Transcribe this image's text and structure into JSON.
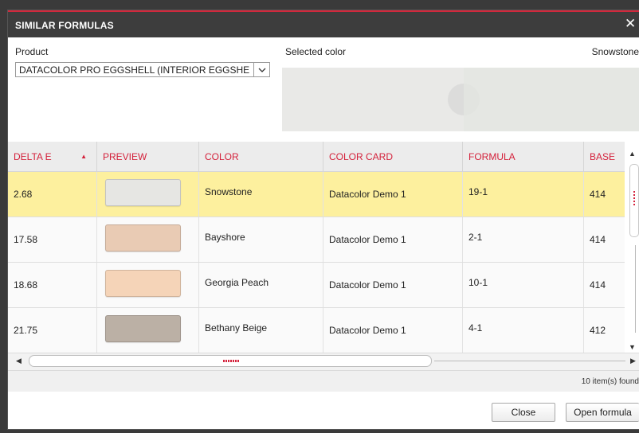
{
  "dialog": {
    "title": "SIMILAR FORMULAS",
    "close_glyph": "✕"
  },
  "product": {
    "label": "Product",
    "selected": "DATACOLOR PRO EGGSHELL (INTERIOR EGGSHELL)"
  },
  "selected_color": {
    "label": "Selected color",
    "name": "Snowstone",
    "left_color": "#e9e9e7",
    "right_color": "#e5e7e3"
  },
  "table": {
    "columns": [
      "DELTA E",
      "PREVIEW",
      "COLOR",
      "COLOR CARD",
      "FORMULA",
      "BASE"
    ],
    "sort_column": "DELTA E",
    "sort_direction": "ascending",
    "rows": [
      {
        "delta_e": "2.68",
        "preview": "#e6e6e3",
        "color": "Snowstone",
        "color_card": "Datacolor Demo 1",
        "formula": "19-1",
        "base": "414",
        "selected": true
      },
      {
        "delta_e": "17.58",
        "preview": "#e9cbb4",
        "color": "Bayshore",
        "color_card": "Datacolor Demo 1",
        "formula": "2-1",
        "base": "414",
        "selected": false
      },
      {
        "delta_e": "18.68",
        "preview": "#f5d4b8",
        "color": "Georgia Peach",
        "color_card": "Datacolor Demo 1",
        "formula": "10-1",
        "base": "414",
        "selected": false
      },
      {
        "delta_e": "21.75",
        "preview": "#bbb0a5",
        "color": "Bethany Beige",
        "color_card": "Datacolor Demo 1",
        "formula": "4-1",
        "base": "412",
        "selected": false
      }
    ]
  },
  "status": {
    "count_text": "10 item(s) found"
  },
  "buttons": {
    "close": "Close",
    "open_formula": "Open formula"
  },
  "colors": {
    "accent": "#d4213b",
    "selected_row": "#fdf09e",
    "titlebar": "#3d3d3d"
  }
}
